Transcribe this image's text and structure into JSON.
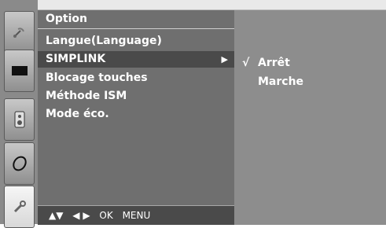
{
  "panel": {
    "title": "Option",
    "items": [
      {
        "label": "Langue(Language)"
      },
      {
        "label": "SIMPLINK",
        "selected": true,
        "arrow": "▶"
      },
      {
        "label": "Blocage touches"
      },
      {
        "label": "Méthode ISM"
      },
      {
        "label": "Mode éco."
      }
    ]
  },
  "submenu": {
    "items": [
      {
        "label": "Arrêt",
        "check": "√"
      },
      {
        "label": "Marche"
      }
    ]
  },
  "footer": {
    "nav_updown": "▲▼",
    "nav_leftright": "◀ ▶",
    "ok_label": "OK",
    "menu_label": "MENU"
  },
  "rail": {
    "icons": [
      "satellite-dish-icon",
      "screen-icon",
      "speaker-icon",
      "clock-icon",
      "key-icon"
    ]
  },
  "colors": {
    "panel": "#6f6f6f",
    "selected": "#4a4a4a",
    "submenu": "#8d8d8d",
    "rail": "#8a8a8a",
    "text": "#ffffff"
  }
}
